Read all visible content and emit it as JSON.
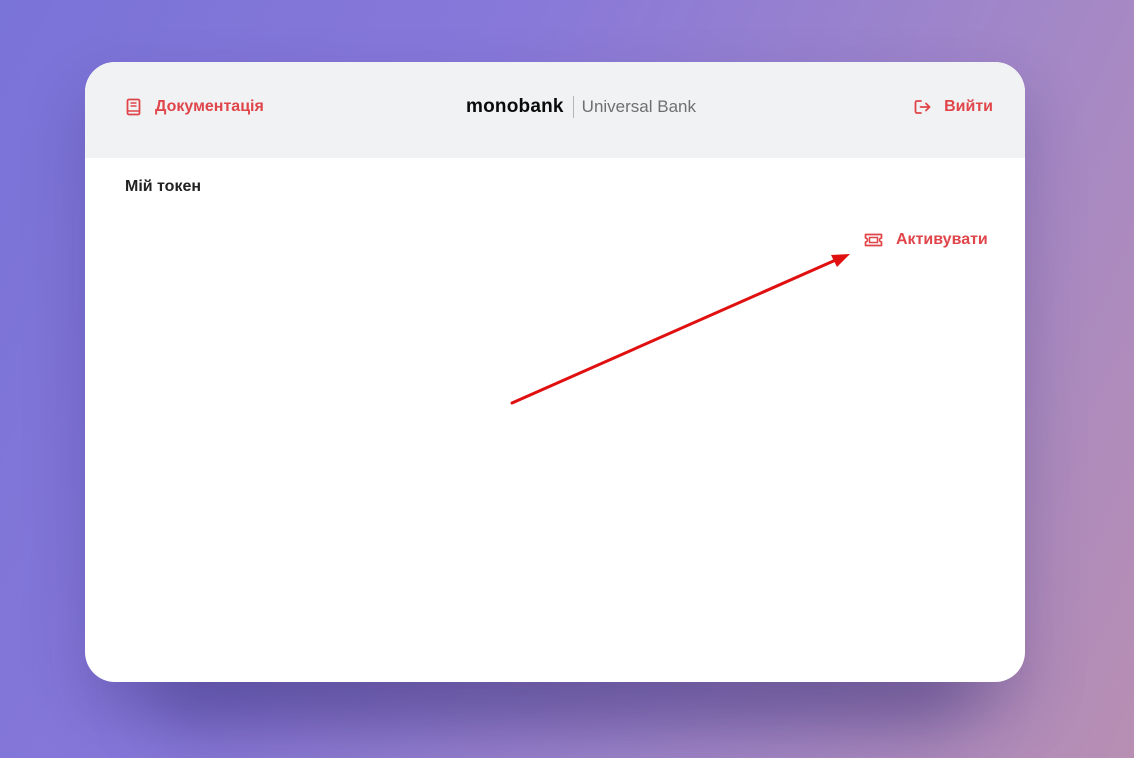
{
  "header": {
    "docs_label": "Документація",
    "docs_icon": "book-icon",
    "logo_main": "monobank",
    "logo_sub": "Universal Bank",
    "logout_label": "Вийти",
    "logout_icon": "logout-icon"
  },
  "main": {
    "title": "Мій токен",
    "activate_label": "Активувати",
    "activate_icon": "ticket-icon"
  },
  "annotation": {
    "type": "red-arrow",
    "points_to": "activate-button"
  },
  "colors": {
    "accent": "#e0454a",
    "header_bg": "#f1f2f4",
    "arrow": "#e01010"
  }
}
